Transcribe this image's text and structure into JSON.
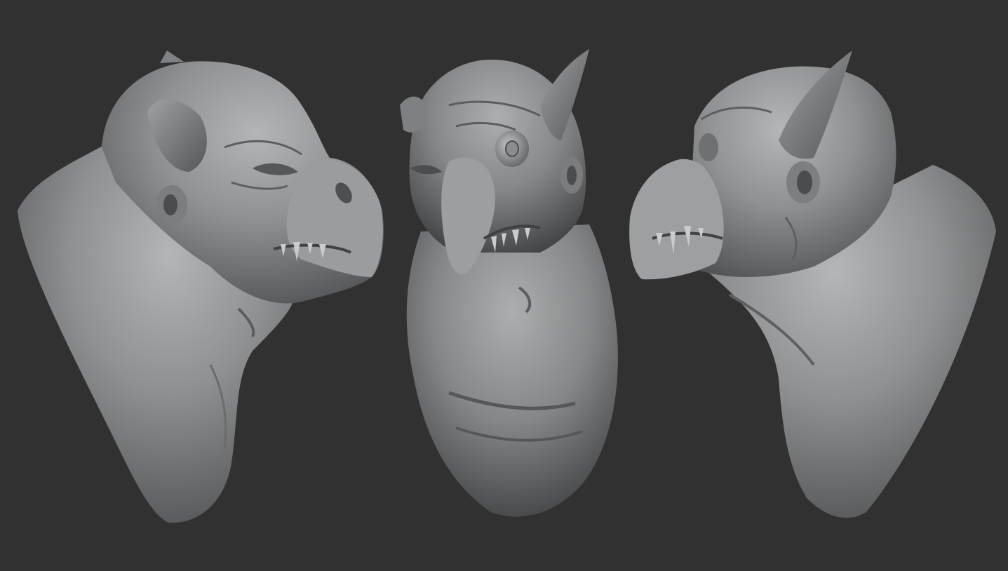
{
  "scene": {
    "background": "#313132",
    "clay": "#8b8d8e",
    "clay_light": "#b4b6b7",
    "clay_dark": "#3e4041",
    "views": [
      {
        "name": "left-three-quarter-view",
        "facing": "right"
      },
      {
        "name": "front-view",
        "facing": "front"
      },
      {
        "name": "right-three-quarter-view",
        "facing": "left"
      }
    ]
  }
}
